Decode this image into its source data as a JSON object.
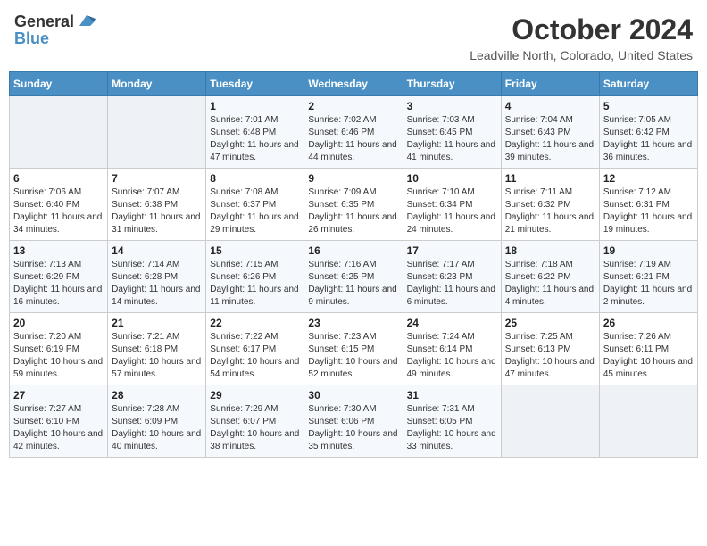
{
  "header": {
    "logo_general": "General",
    "logo_blue": "Blue",
    "title": "October 2024",
    "subtitle": "Leadville North, Colorado, United States"
  },
  "days_of_week": [
    "Sunday",
    "Monday",
    "Tuesday",
    "Wednesday",
    "Thursday",
    "Friday",
    "Saturday"
  ],
  "weeks": [
    [
      {
        "day": "",
        "sunrise": "",
        "sunset": "",
        "daylight": "",
        "empty": true
      },
      {
        "day": "",
        "sunrise": "",
        "sunset": "",
        "daylight": "",
        "empty": true
      },
      {
        "day": "1",
        "sunrise": "Sunrise: 7:01 AM",
        "sunset": "Sunset: 6:48 PM",
        "daylight": "Daylight: 11 hours and 47 minutes."
      },
      {
        "day": "2",
        "sunrise": "Sunrise: 7:02 AM",
        "sunset": "Sunset: 6:46 PM",
        "daylight": "Daylight: 11 hours and 44 minutes."
      },
      {
        "day": "3",
        "sunrise": "Sunrise: 7:03 AM",
        "sunset": "Sunset: 6:45 PM",
        "daylight": "Daylight: 11 hours and 41 minutes."
      },
      {
        "day": "4",
        "sunrise": "Sunrise: 7:04 AM",
        "sunset": "Sunset: 6:43 PM",
        "daylight": "Daylight: 11 hours and 39 minutes."
      },
      {
        "day": "5",
        "sunrise": "Sunrise: 7:05 AM",
        "sunset": "Sunset: 6:42 PM",
        "daylight": "Daylight: 11 hours and 36 minutes."
      }
    ],
    [
      {
        "day": "6",
        "sunrise": "Sunrise: 7:06 AM",
        "sunset": "Sunset: 6:40 PM",
        "daylight": "Daylight: 11 hours and 34 minutes."
      },
      {
        "day": "7",
        "sunrise": "Sunrise: 7:07 AM",
        "sunset": "Sunset: 6:38 PM",
        "daylight": "Daylight: 11 hours and 31 minutes."
      },
      {
        "day": "8",
        "sunrise": "Sunrise: 7:08 AM",
        "sunset": "Sunset: 6:37 PM",
        "daylight": "Daylight: 11 hours and 29 minutes."
      },
      {
        "day": "9",
        "sunrise": "Sunrise: 7:09 AM",
        "sunset": "Sunset: 6:35 PM",
        "daylight": "Daylight: 11 hours and 26 minutes."
      },
      {
        "day": "10",
        "sunrise": "Sunrise: 7:10 AM",
        "sunset": "Sunset: 6:34 PM",
        "daylight": "Daylight: 11 hours and 24 minutes."
      },
      {
        "day": "11",
        "sunrise": "Sunrise: 7:11 AM",
        "sunset": "Sunset: 6:32 PM",
        "daylight": "Daylight: 11 hours and 21 minutes."
      },
      {
        "day": "12",
        "sunrise": "Sunrise: 7:12 AM",
        "sunset": "Sunset: 6:31 PM",
        "daylight": "Daylight: 11 hours and 19 minutes."
      }
    ],
    [
      {
        "day": "13",
        "sunrise": "Sunrise: 7:13 AM",
        "sunset": "Sunset: 6:29 PM",
        "daylight": "Daylight: 11 hours and 16 minutes."
      },
      {
        "day": "14",
        "sunrise": "Sunrise: 7:14 AM",
        "sunset": "Sunset: 6:28 PM",
        "daylight": "Daylight: 11 hours and 14 minutes."
      },
      {
        "day": "15",
        "sunrise": "Sunrise: 7:15 AM",
        "sunset": "Sunset: 6:26 PM",
        "daylight": "Daylight: 11 hours and 11 minutes."
      },
      {
        "day": "16",
        "sunrise": "Sunrise: 7:16 AM",
        "sunset": "Sunset: 6:25 PM",
        "daylight": "Daylight: 11 hours and 9 minutes."
      },
      {
        "day": "17",
        "sunrise": "Sunrise: 7:17 AM",
        "sunset": "Sunset: 6:23 PM",
        "daylight": "Daylight: 11 hours and 6 minutes."
      },
      {
        "day": "18",
        "sunrise": "Sunrise: 7:18 AM",
        "sunset": "Sunset: 6:22 PM",
        "daylight": "Daylight: 11 hours and 4 minutes."
      },
      {
        "day": "19",
        "sunrise": "Sunrise: 7:19 AM",
        "sunset": "Sunset: 6:21 PM",
        "daylight": "Daylight: 11 hours and 2 minutes."
      }
    ],
    [
      {
        "day": "20",
        "sunrise": "Sunrise: 7:20 AM",
        "sunset": "Sunset: 6:19 PM",
        "daylight": "Daylight: 10 hours and 59 minutes."
      },
      {
        "day": "21",
        "sunrise": "Sunrise: 7:21 AM",
        "sunset": "Sunset: 6:18 PM",
        "daylight": "Daylight: 10 hours and 57 minutes."
      },
      {
        "day": "22",
        "sunrise": "Sunrise: 7:22 AM",
        "sunset": "Sunset: 6:17 PM",
        "daylight": "Daylight: 10 hours and 54 minutes."
      },
      {
        "day": "23",
        "sunrise": "Sunrise: 7:23 AM",
        "sunset": "Sunset: 6:15 PM",
        "daylight": "Daylight: 10 hours and 52 minutes."
      },
      {
        "day": "24",
        "sunrise": "Sunrise: 7:24 AM",
        "sunset": "Sunset: 6:14 PM",
        "daylight": "Daylight: 10 hours and 49 minutes."
      },
      {
        "day": "25",
        "sunrise": "Sunrise: 7:25 AM",
        "sunset": "Sunset: 6:13 PM",
        "daylight": "Daylight: 10 hours and 47 minutes."
      },
      {
        "day": "26",
        "sunrise": "Sunrise: 7:26 AM",
        "sunset": "Sunset: 6:11 PM",
        "daylight": "Daylight: 10 hours and 45 minutes."
      }
    ],
    [
      {
        "day": "27",
        "sunrise": "Sunrise: 7:27 AM",
        "sunset": "Sunset: 6:10 PM",
        "daylight": "Daylight: 10 hours and 42 minutes."
      },
      {
        "day": "28",
        "sunrise": "Sunrise: 7:28 AM",
        "sunset": "Sunset: 6:09 PM",
        "daylight": "Daylight: 10 hours and 40 minutes."
      },
      {
        "day": "29",
        "sunrise": "Sunrise: 7:29 AM",
        "sunset": "Sunset: 6:07 PM",
        "daylight": "Daylight: 10 hours and 38 minutes."
      },
      {
        "day": "30",
        "sunrise": "Sunrise: 7:30 AM",
        "sunset": "Sunset: 6:06 PM",
        "daylight": "Daylight: 10 hours and 35 minutes."
      },
      {
        "day": "31",
        "sunrise": "Sunrise: 7:31 AM",
        "sunset": "Sunset: 6:05 PM",
        "daylight": "Daylight: 10 hours and 33 minutes."
      },
      {
        "day": "",
        "sunrise": "",
        "sunset": "",
        "daylight": "",
        "empty": true
      },
      {
        "day": "",
        "sunrise": "",
        "sunset": "",
        "daylight": "",
        "empty": true
      }
    ]
  ]
}
